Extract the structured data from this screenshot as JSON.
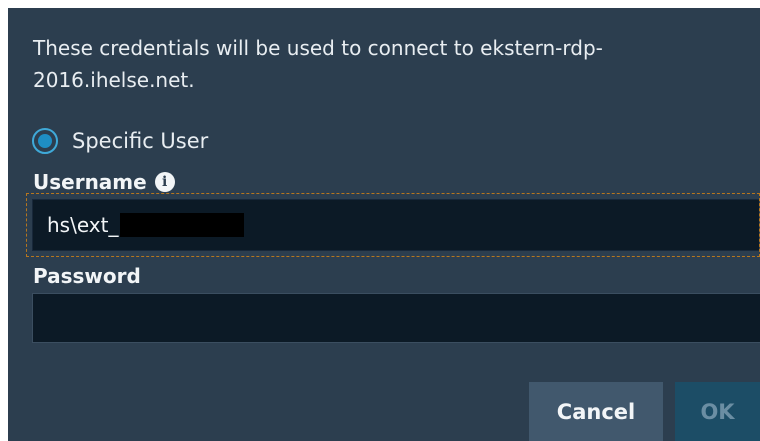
{
  "dialog": {
    "description": "These credentials will be used to connect to ekstern-rdp-2016.ihelse.net.",
    "radio_option": {
      "label": "Specific User",
      "selected": true
    },
    "username": {
      "label": "Username",
      "value": "hs\\ext_",
      "info_icon": "info-icon"
    },
    "password": {
      "label": "Password",
      "value": ""
    },
    "buttons": {
      "cancel": "Cancel",
      "ok": "OK"
    }
  },
  "colors": {
    "dialog_bg": "#2c3e4f",
    "input_bg": "#0c1a26",
    "radio_accent": "#1e8ec4",
    "focus_outline": "#b7761e",
    "cancel_bg": "#41586d",
    "ok_bg": "#1c4d66",
    "ok_text_disabled": "#6b8ea3"
  }
}
